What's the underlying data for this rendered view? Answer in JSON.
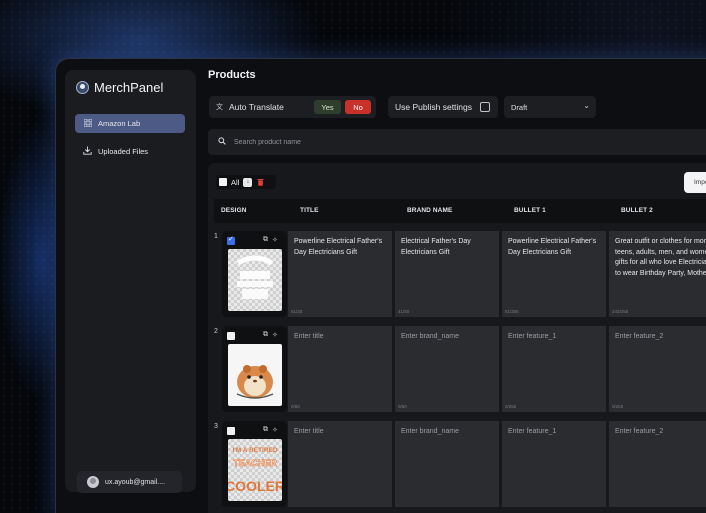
{
  "app": {
    "name": "MerchPanel"
  },
  "sidebar": {
    "items": [
      {
        "label": "Amazon Lab",
        "icon": "grid-icon",
        "active": true
      },
      {
        "label": "Uploaded Files",
        "icon": "download-icon",
        "active": false
      }
    ],
    "user": {
      "email": "ux.ayoub@gmail...."
    }
  },
  "page": {
    "title": "Products"
  },
  "toolbar": {
    "auto_translate_label": "Auto Translate",
    "yes_label": "Yes",
    "no_label": "No",
    "publish_settings_label": "Use Publish settings",
    "status_value": "Draft"
  },
  "search": {
    "placeholder": "Search product name"
  },
  "bulk": {
    "all_label": "All"
  },
  "import_button": {
    "label": "Impo"
  },
  "table": {
    "columns": [
      "DESIGN",
      "TITLE",
      "BRAND NAME",
      "BULLET 1",
      "BULLET 2"
    ],
    "rows": [
      {
        "num": "1",
        "checked": true,
        "title": "Powerline Electrical Father's Day Electricians Gift",
        "title_count": "51/30",
        "brand": "Electrical Father's Day Electricians Gift",
        "brand_count": "41/50",
        "bullet1": "Powerline Electrical Father's Day Electricians Gift",
        "bullet1_count": "51/255",
        "bullet2": "Great outfit or clothes for mom, dad, teens, adults, men, and women. Design gifts for all who love Electricians. Suits to wear Birthday Party, Mother's",
        "bullet2_count": "243/255"
      },
      {
        "num": "2",
        "checked": false,
        "title": "Enter title",
        "title_count": "0/60",
        "brand": "Enter brand_name",
        "brand_count": "0/50",
        "bullet1": "Enter feature_1",
        "bullet1_count": "0/255",
        "bullet2": "Enter feature_2",
        "bullet2_count": "0/255"
      },
      {
        "num": "3",
        "checked": false,
        "title": "Enter title",
        "title_count": "",
        "brand": "Enter brand_name",
        "brand_count": "",
        "bullet1": "Enter feature_1",
        "bullet1_count": "",
        "bullet2": "Enter feature_2",
        "bullet2_count": ""
      }
    ],
    "design3_text": [
      "I'M A RETIRED",
      "TEACHER",
      "COOLER"
    ]
  },
  "colors": {
    "accent": "#4e5a86",
    "danger": "#c9302a",
    "yes_bg": "#2e3d2c",
    "checkbox": "#3a6ee8",
    "design3_orange": "#e0773a"
  }
}
